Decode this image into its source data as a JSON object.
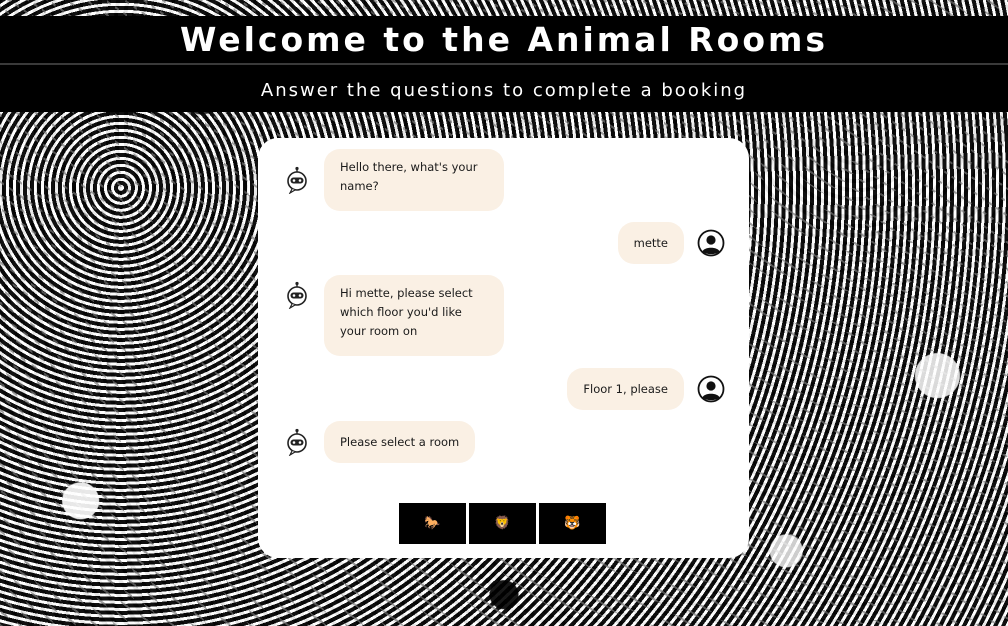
{
  "header": {
    "title": "Welcome to the Animal Rooms",
    "subtitle": "Answer the questions to complete a booking"
  },
  "chat": {
    "messages": [
      {
        "sender": "bot",
        "avatar_icon": "robot-icon",
        "text": "Hello there, what's your name?"
      },
      {
        "sender": "user",
        "avatar_icon": "user-icon",
        "text": "mette"
      },
      {
        "sender": "bot",
        "avatar_icon": "robot-icon",
        "text": "Hi mette, please select which floor you'd like your room on"
      },
      {
        "sender": "user",
        "avatar_icon": "user-icon",
        "text": "Floor 1, please"
      },
      {
        "sender": "bot",
        "avatar_icon": "robot-icon",
        "text": "Please select a room"
      }
    ],
    "room_options": [
      {
        "label": "🐎",
        "icon": "horse-icon"
      },
      {
        "label": "🦁",
        "icon": "lion-icon"
      },
      {
        "label": "🐯",
        "icon": "tiger-icon"
      }
    ]
  },
  "colors": {
    "bubble": "#faf0e4",
    "header_band": "#000000",
    "card": "#ffffff",
    "button": "#000000"
  }
}
